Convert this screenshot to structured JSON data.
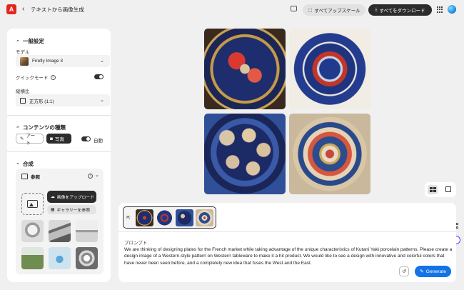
{
  "header": {
    "back_arrow": "‹",
    "title": "テキストから画像生成",
    "upscale_all": "すべてアップスケール",
    "download_all": "すべてをダウンロード"
  },
  "general": {
    "title": "一般設定",
    "model_label": "モデル",
    "model_value": "Firefly Image 3",
    "quick_mode_label": "クイックモード",
    "quick_mode_on": true,
    "aspect_label": "縦横比",
    "aspect_value": "正方形 (1:1)"
  },
  "content_type": {
    "title": "コンテンツの種類",
    "art_label": "アート",
    "photo_label": "写真",
    "auto_label": "自動",
    "auto_on": true,
    "selected": "写真"
  },
  "composition": {
    "title": "合成",
    "reference_label": "参照",
    "upload_button": "画像をアップロード",
    "gallery_button": "ギャラリーを参照"
  },
  "prompt": {
    "label": "プロンプト",
    "text": "We are thinking of designing plates for the French market while taking advantage of the unique characteristics of Kutani Yaki porcelain patterns. Please create a design image of a Western-style pattern on Western tableware to make it a hit product. We would like to see a design with innovative and colorful colors that have never been seen before, and a completely new idea that fuses the West and the East.",
    "generate_button": "Generate"
  },
  "colors": {
    "accent": "#1473e6",
    "logo": "#e1251b",
    "dark_button": "#2c2c2c"
  }
}
